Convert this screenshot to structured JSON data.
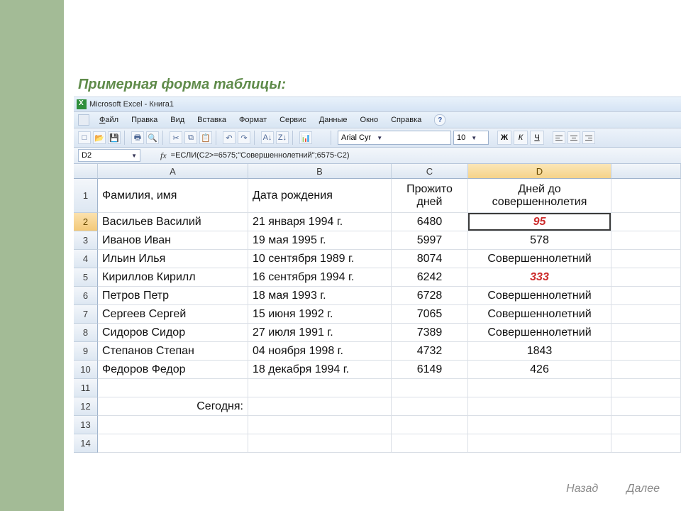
{
  "slide_title": "Примерная форма таблицы:",
  "titlebar": "Microsoft Excel - Книга1",
  "menus": {
    "file": "Файл",
    "edit": "Правка",
    "view": "Вид",
    "insert": "Вставка",
    "format": "Формат",
    "tools": "Сервис",
    "data": "Данные",
    "window": "Окно",
    "help": "Справка"
  },
  "font": {
    "name": "Arial Cyr",
    "size": "10"
  },
  "style_buttons": {
    "bold": "Ж",
    "italic": "К",
    "underline": "Ч"
  },
  "namebox": "D2",
  "fx_symbol": "fx",
  "formula": "=ЕСЛИ(C2>=6575;\"Совершеннолетний\";6575-C2)",
  "columns": {
    "a": "A",
    "b": "B",
    "c": "C",
    "d": "D"
  },
  "header_row": {
    "a": "Фамилия, имя",
    "b": "Дата рождения",
    "c": "Прожито дней",
    "d": "Дней до совершеннолетия"
  },
  "rows": [
    {
      "n": "2",
      "a": "Васильев Василий",
      "b": "21 января 1994 г.",
      "c": "6480",
      "d": "95",
      "d_red": true,
      "active": true
    },
    {
      "n": "3",
      "a": "Иванов Иван",
      "b": "19 мая 1995 г.",
      "c": "5997",
      "d": "578"
    },
    {
      "n": "4",
      "a": "Ильин Илья",
      "b": "10 сентября 1989 г.",
      "c": "8074",
      "d": "Совершеннолетний"
    },
    {
      "n": "5",
      "a": "Кириллов Кирилл",
      "b": "16 сентября 1994 г.",
      "c": "6242",
      "d": "333",
      "d_red": true
    },
    {
      "n": "6",
      "a": "Петров Петр",
      "b": "18 мая 1993 г.",
      "c": "6728",
      "d": "Совершеннолетний"
    },
    {
      "n": "7",
      "a": "Сергеев Сергей",
      "b": "15 июня 1992 г.",
      "c": "7065",
      "d": "Совершеннолетний"
    },
    {
      "n": "8",
      "a": "Сидоров Сидор",
      "b": "27 июля 1991 г.",
      "c": "7389",
      "d": "Совершеннолетний"
    },
    {
      "n": "9",
      "a": "Степанов Степан",
      "b": "04 ноября 1998 г.",
      "c": "4732",
      "d": "1843"
    },
    {
      "n": "10",
      "a": "Федоров Федор",
      "b": "18 декабря 1994 г.",
      "c": "6149",
      "d": "426"
    },
    {
      "n": "11",
      "a": "",
      "b": "",
      "c": "",
      "d": ""
    },
    {
      "n": "12",
      "a": "Сегодня:",
      "a_right": true,
      "b": "",
      "c": "",
      "d": ""
    },
    {
      "n": "13",
      "a": "",
      "b": "",
      "c": "",
      "d": ""
    },
    {
      "n": "14",
      "a": "",
      "b": "",
      "c": "",
      "d": ""
    }
  ],
  "footer": {
    "back": "Назад",
    "next": "Далее"
  }
}
